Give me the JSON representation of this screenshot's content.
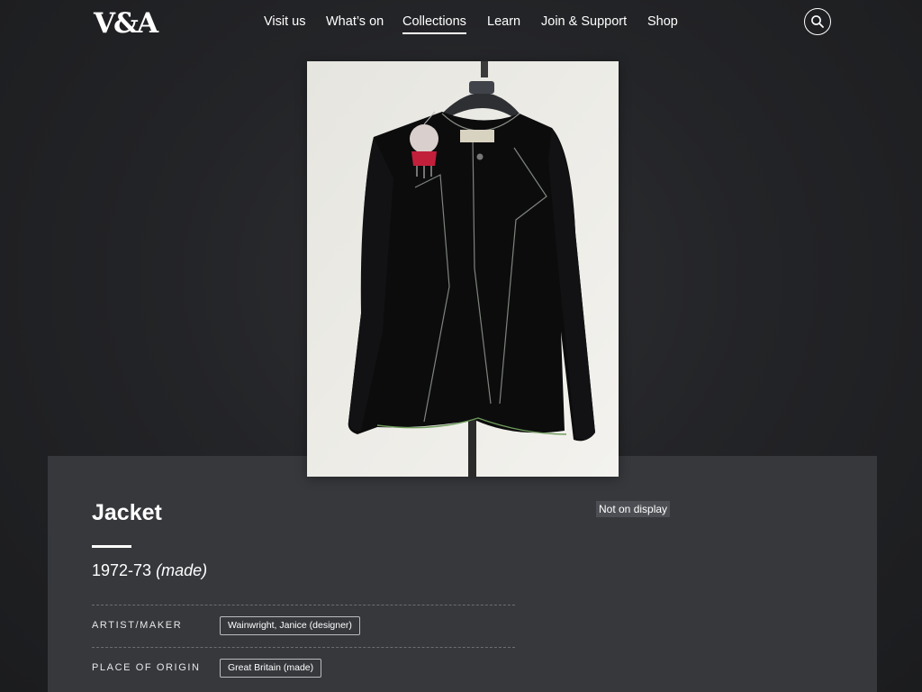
{
  "header": {
    "logo": "V&A",
    "nav": [
      {
        "label": "Visit us",
        "active": false
      },
      {
        "label": "What’s on",
        "active": false
      },
      {
        "label": "Collections",
        "active": true
      },
      {
        "label": "Learn",
        "active": false
      },
      {
        "label": "Join & Support",
        "active": false
      },
      {
        "label": "Shop",
        "active": false
      }
    ],
    "search_icon": "search-icon"
  },
  "object": {
    "title": "Jacket",
    "date": "1972-73",
    "date_qualifier": "(made)",
    "status": "Not on display",
    "details": [
      {
        "label": "ARTIST/MAKER",
        "value": "Wainwright, Janice (designer)"
      },
      {
        "label": "PLACE OF ORIGIN",
        "value": "Great Britain (made)"
      }
    ]
  },
  "colors": {
    "background": "#1d1e20",
    "panel": "#36383c",
    "text": "#ffffff",
    "badge": "#4c4e53"
  }
}
